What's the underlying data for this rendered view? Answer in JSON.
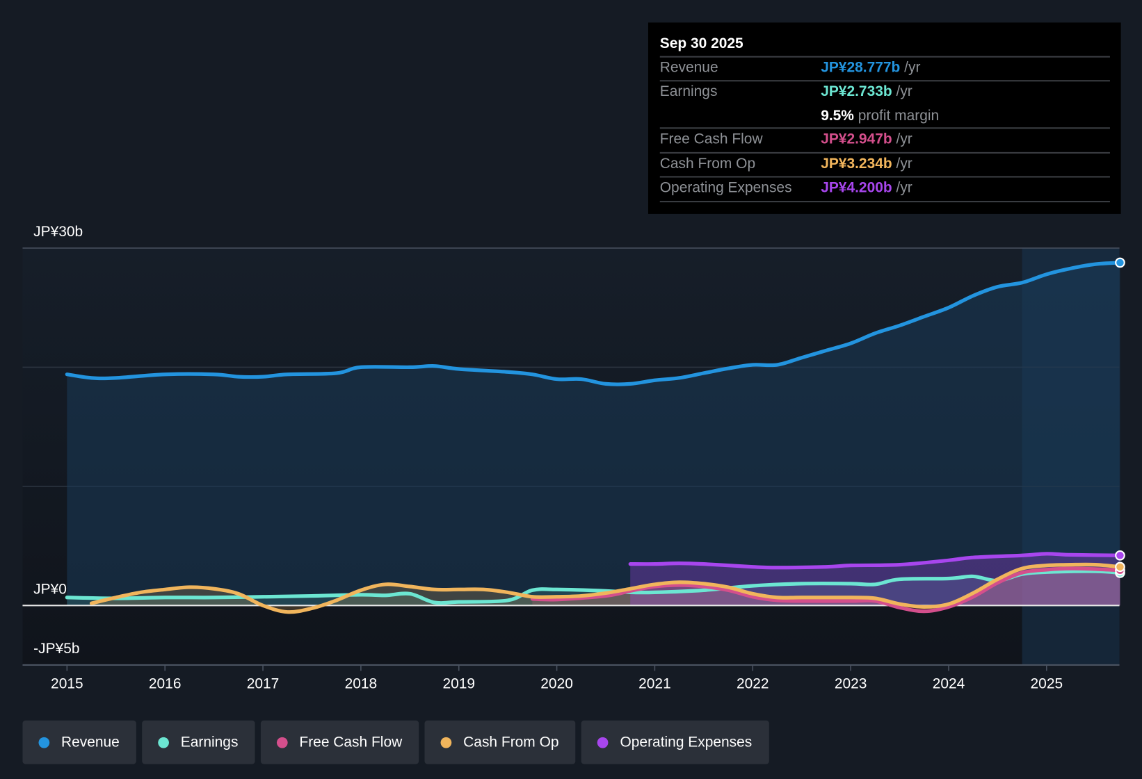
{
  "tooltip": {
    "date": "Sep 30 2025",
    "unit": "/yr",
    "rows": [
      {
        "label": "Revenue",
        "value": "JP¥28.777b",
        "color": "#2394df"
      },
      {
        "label": "Earnings",
        "value": "JP¥2.733b",
        "color": "#6ce6d2",
        "extra_value": "9.5%",
        "extra_label": "profit margin"
      },
      {
        "label": "Free Cash Flow",
        "value": "JP¥2.947b",
        "color": "#d44f8c"
      },
      {
        "label": "Cash From Op",
        "value": "JP¥3.234b",
        "color": "#f1b55c"
      },
      {
        "label": "Operating Expenses",
        "value": "JP¥4.200b",
        "color": "#a846ee"
      }
    ]
  },
  "chart_data": {
    "type": "line",
    "ylim": [
      -5,
      30
    ],
    "xlim": [
      2014.55,
      2025.75
    ],
    "y_tick_labels": [
      {
        "v": 30,
        "t": "JP¥30b"
      },
      {
        "v": 0,
        "t": "JP¥0"
      },
      {
        "v": -5,
        "t": "-JP¥5b"
      }
    ],
    "x_tick_labels": [
      "2015",
      "2016",
      "2017",
      "2018",
      "2019",
      "2020",
      "2021",
      "2022",
      "2023",
      "2024",
      "2025"
    ],
    "grid": true,
    "highlight_from": 2024.75,
    "series": [
      {
        "name": "Revenue",
        "color": "#2394df",
        "x": [
          2015,
          2015.25,
          2015.5,
          2016,
          2016.5,
          2016.75,
          2017,
          2017.25,
          2017.75,
          2018,
          2018.5,
          2018.75,
          2019,
          2019.5,
          2019.75,
          2020,
          2020.25,
          2020.5,
          2020.75,
          2021,
          2021.25,
          2021.5,
          2021.75,
          2022,
          2022.25,
          2022.5,
          2022.75,
          2023,
          2023.25,
          2023.5,
          2023.75,
          2024,
          2024.25,
          2024.5,
          2024.75,
          2025,
          2025.25,
          2025.5,
          2025.75
        ],
        "values": [
          19.4,
          19.1,
          19.1,
          19.4,
          19.4,
          19.2,
          19.2,
          19.4,
          19.5,
          20.0,
          20.0,
          20.1,
          19.85,
          19.6,
          19.4,
          19.0,
          19.0,
          18.6,
          18.6,
          18.9,
          19.1,
          19.5,
          19.9,
          20.2,
          20.2,
          20.8,
          21.4,
          22.0,
          22.85,
          23.5,
          24.25,
          25.0,
          26.0,
          26.75,
          27.1,
          27.8,
          28.3,
          28.65,
          28.777
        ]
      },
      {
        "name": "Earnings",
        "color": "#6ce6d2",
        "x": [
          2015,
          2015.5,
          2016,
          2016.5,
          2017,
          2017.5,
          2018,
          2018.25,
          2018.5,
          2018.75,
          2019,
          2019.5,
          2019.75,
          2020,
          2020.5,
          2020.75,
          2021,
          2021.5,
          2022,
          2022.5,
          2023,
          2023.25,
          2023.5,
          2024,
          2024.25,
          2024.5,
          2024.75,
          2025,
          2025.5,
          2025.75
        ],
        "values": [
          0.67,
          0.6,
          0.67,
          0.67,
          0.73,
          0.8,
          0.9,
          0.85,
          0.98,
          0.25,
          0.3,
          0.43,
          1.28,
          1.34,
          1.22,
          1.1,
          1.1,
          1.28,
          1.65,
          1.83,
          1.83,
          1.77,
          2.2,
          2.26,
          2.44,
          2.08,
          2.63,
          2.8,
          2.87,
          2.733
        ]
      },
      {
        "name": "Free Cash Flow",
        "color": "#d44f8c",
        "x": [
          2019.75,
          2020,
          2020.5,
          2020.75,
          2021,
          2021.25,
          2021.5,
          2021.75,
          2022,
          2022.25,
          2022.5,
          2023,
          2023.25,
          2023.5,
          2023.75,
          2024,
          2024.25,
          2024.5,
          2024.75,
          2025,
          2025.25,
          2025.5,
          2025.75
        ],
        "values": [
          0.55,
          0.5,
          0.8,
          1.22,
          1.59,
          1.71,
          1.59,
          1.28,
          0.73,
          0.43,
          0.37,
          0.37,
          0.37,
          -0.18,
          -0.49,
          -0.12,
          0.73,
          1.9,
          2.75,
          3.0,
          3.1,
          3.05,
          2.947
        ]
      },
      {
        "name": "Cash From Op",
        "color": "#f1b55c",
        "x": [
          2015.25,
          2015.5,
          2015.75,
          2016,
          2016.25,
          2016.5,
          2016.75,
          2017,
          2017.25,
          2017.5,
          2017.75,
          2018,
          2018.25,
          2018.5,
          2018.75,
          2019,
          2019.25,
          2019.5,
          2019.75,
          2020,
          2020.25,
          2020.5,
          2020.75,
          2021,
          2021.25,
          2021.5,
          2021.75,
          2022,
          2022.25,
          2022.5,
          2023,
          2023.25,
          2023.5,
          2023.75,
          2024,
          2024.25,
          2024.5,
          2024.75,
          2025,
          2025.25,
          2025.5,
          2025.75
        ],
        "values": [
          0.18,
          0.67,
          1.1,
          1.34,
          1.53,
          1.4,
          0.98,
          0,
          -0.55,
          -0.24,
          0.43,
          1.28,
          1.77,
          1.59,
          1.34,
          1.34,
          1.34,
          1.1,
          0.73,
          0.73,
          0.8,
          1.04,
          1.4,
          1.77,
          1.95,
          1.83,
          1.53,
          0.98,
          0.67,
          0.67,
          0.67,
          0.6,
          0.12,
          -0.12,
          0.12,
          1.04,
          2.2,
          3.1,
          3.36,
          3.42,
          3.42,
          3.234
        ]
      },
      {
        "name": "Operating Expenses",
        "color": "#a846ee",
        "x": [
          2020.75,
          2021,
          2021.25,
          2021.5,
          2022,
          2022.25,
          2022.75,
          2023,
          2023.5,
          2024,
          2024.25,
          2024.75,
          2025,
          2025.25,
          2025.75
        ],
        "values": [
          3.48,
          3.48,
          3.54,
          3.48,
          3.24,
          3.18,
          3.24,
          3.36,
          3.42,
          3.79,
          4.03,
          4.2,
          4.34,
          4.25,
          4.2
        ]
      }
    ]
  }
}
